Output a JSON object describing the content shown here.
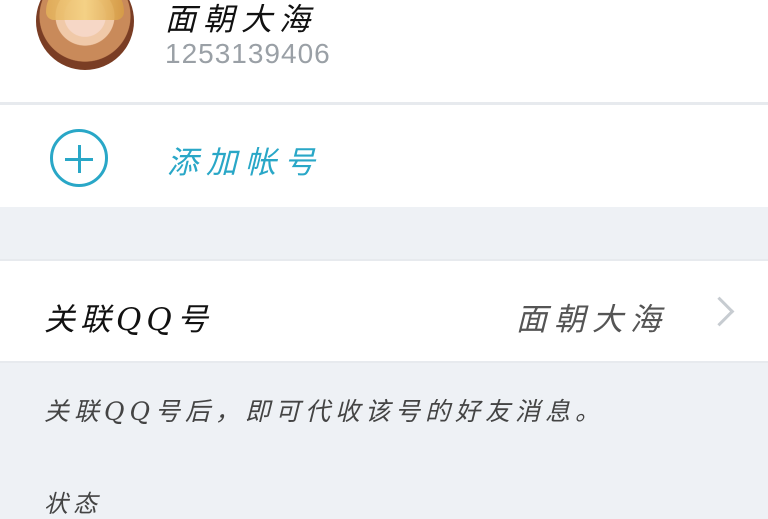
{
  "account": {
    "name": "面朝大海",
    "number": "1253139406"
  },
  "add_account": {
    "label": "添加帐号"
  },
  "link_qq": {
    "label": "关联QQ号",
    "value": "面朝大海"
  },
  "hint": {
    "text": "关联QQ号后，即可代收该号的好友消息。"
  },
  "bottom": {
    "text": "状态"
  },
  "colors": {
    "accent": "#29a7c7",
    "background": "#eef1f5"
  },
  "icons": {
    "avatar": "avatar-photo",
    "add": "plus-circle-icon",
    "chevron": "chevron-right-icon"
  }
}
